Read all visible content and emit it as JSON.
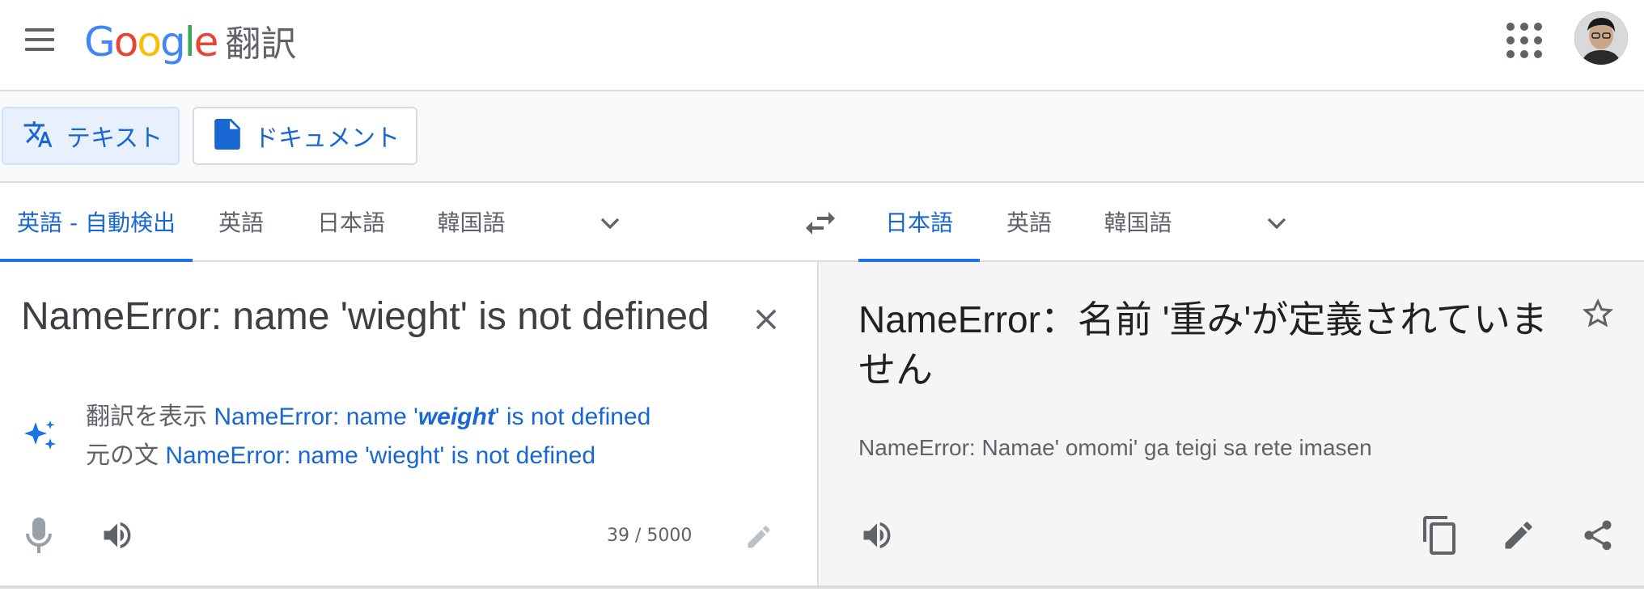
{
  "header": {
    "logo_letters": [
      {
        "ch": "G",
        "color": "#4285F4"
      },
      {
        "ch": "o",
        "color": "#EA4335"
      },
      {
        "ch": "o",
        "color": "#FBBC05"
      },
      {
        "ch": "g",
        "color": "#4285F4"
      },
      {
        "ch": "l",
        "color": "#34A853"
      },
      {
        "ch": "e",
        "color": "#EA4335"
      }
    ],
    "product": "翻訳",
    "icons": [
      "menu-icon",
      "apps-grid-icon",
      "user-avatar"
    ]
  },
  "modes": {
    "text_label": "テキスト",
    "document_label": "ドキュメント"
  },
  "source_langs": {
    "tabs": [
      "英語 - 自動検出",
      "英語",
      "日本語",
      "韓国語"
    ],
    "active_index": 0
  },
  "target_langs": {
    "tabs": [
      "日本語",
      "英語",
      "韓国語"
    ],
    "active_index": 0
  },
  "source": {
    "text": "NameError: name 'wieght' is not defined",
    "suggestion_prefix": "翻訳を表示",
    "suggestion_pre": "NameError: name '",
    "suggestion_bold": "weight",
    "suggestion_post": "' is not defined",
    "original_prefix": "元の文",
    "original_text": "NameError: name 'wieght' is not defined",
    "char_count": "39 / 5000"
  },
  "target": {
    "text": "NameError：名前 '重み'が定義されていません",
    "transliteration": "NameError: Namae' omomi' ga teigi sa rete imasen"
  },
  "colors": {
    "accent": "#1a73e8",
    "accent_text": "#1967d2",
    "icon_gray": "#5f6368",
    "divider": "#dadce0"
  }
}
